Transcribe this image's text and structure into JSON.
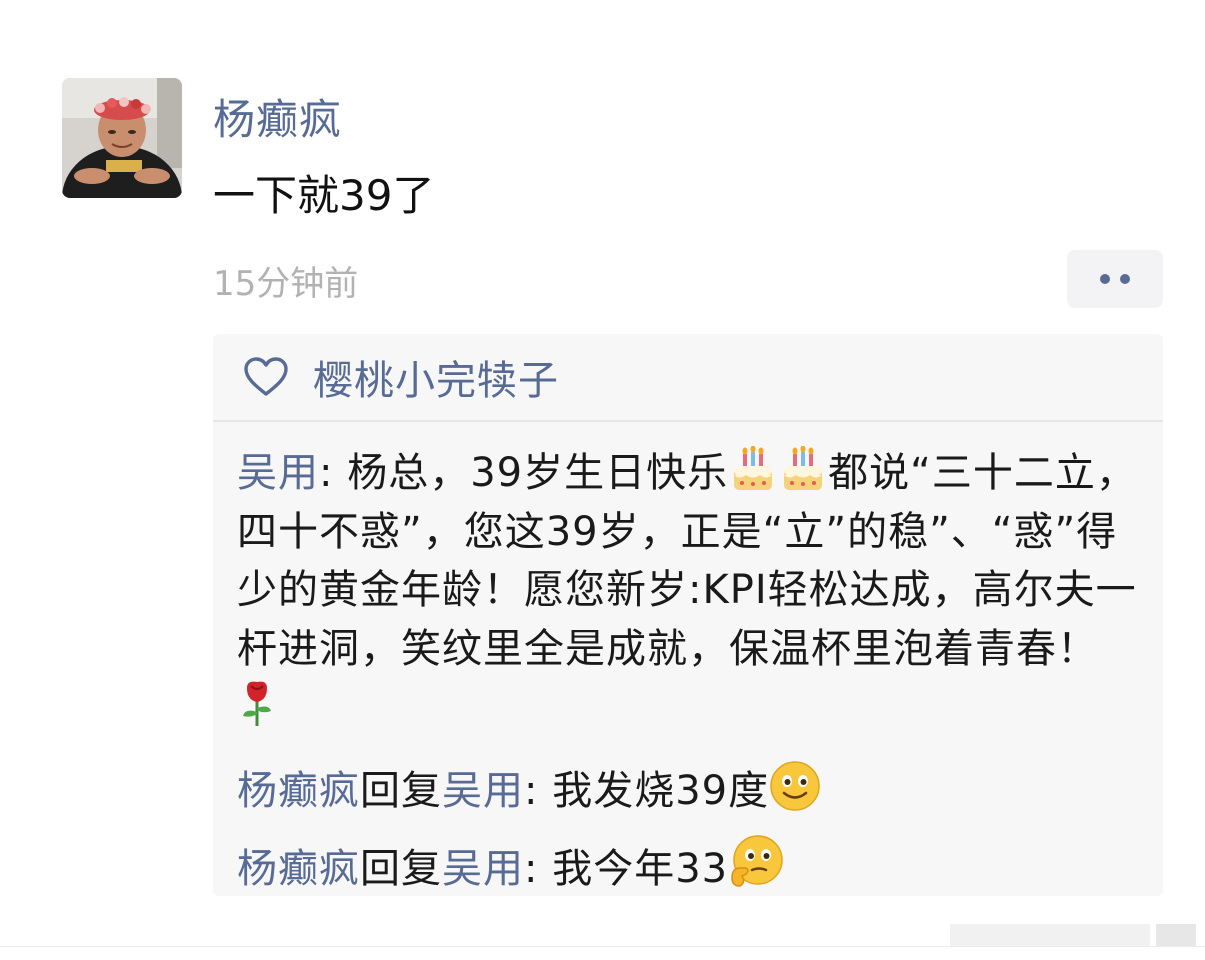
{
  "post": {
    "author": "杨癫疯",
    "text": "一下就39了",
    "time": "15分钟前",
    "avatar_icon": "user-avatar"
  },
  "likes": {
    "icon": "heart-icon",
    "users": "樱桃小完犊子"
  },
  "comments": [
    {
      "author": "吴用",
      "sep": ": ",
      "text_1": "杨总，39岁生日快乐",
      "emoji_1": "birthday-cake-emoji",
      "emoji_2": "birthday-cake-emoji",
      "text_2": "都说“三十二立，四十不惑”，您这39岁，正是“立”的稳”、“惑”得少的黄金年龄！愿您新岁:KPI轻松达成，高尔夫一杆进洞，笑纹里全是成就，保温杯里泡着青春！",
      "emoji_3": "rose-emoji"
    }
  ],
  "replies": [
    {
      "author": "杨癫疯",
      "reply_word": "回复",
      "target": "吴用",
      "sep": ": ",
      "text": "我发烧39度",
      "emoji": "smile-emoji"
    },
    {
      "author": "杨癫疯",
      "reply_word": "回复",
      "target": "吴用",
      "sep": ": ",
      "text": "我今年33",
      "emoji": "thinking-emoji"
    }
  ],
  "colors": {
    "name_link": "#576b95",
    "text": "#1a1a1a",
    "timestamp": "#b2b2b2",
    "panel_bg": "#f7f7f7"
  }
}
